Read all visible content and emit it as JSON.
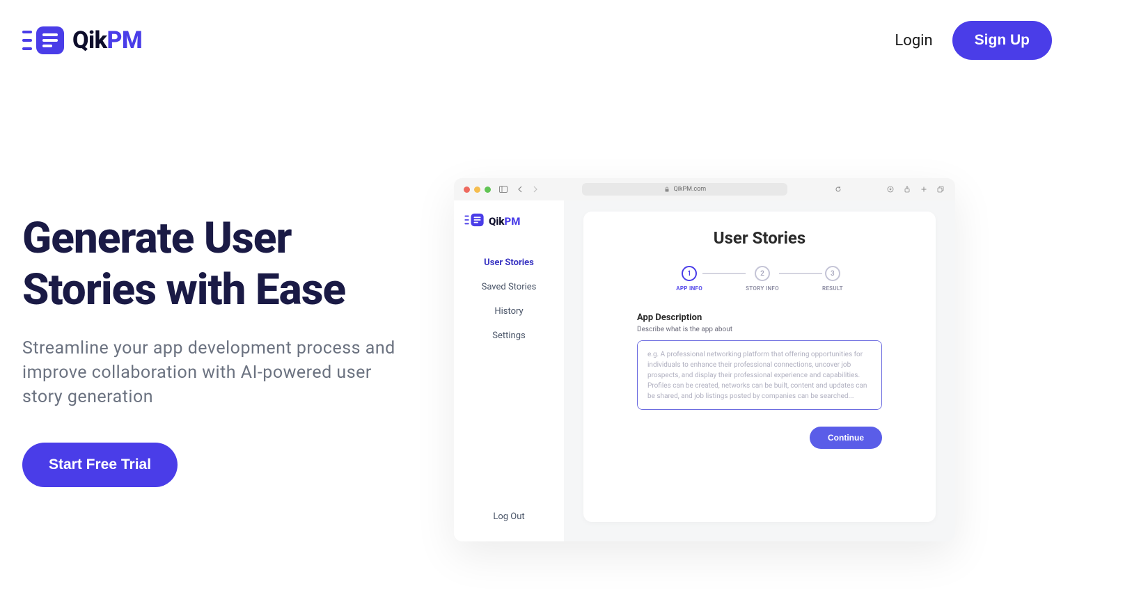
{
  "header": {
    "logo_qik": "Qik",
    "logo_pm": "PM",
    "login_label": "Login",
    "signup_label": "Sign Up"
  },
  "hero": {
    "title": "Generate User Stories with Ease",
    "subtitle": "Streamline your app development process and improve collaboration with AI-powered user story generation",
    "cta_label": "Start Free Trial"
  },
  "browser": {
    "url_label": "QikPM.com",
    "app_logo_qik": "Qik",
    "app_logo_pm": "PM",
    "sidebar": {
      "items": [
        {
          "label": "User Stories",
          "active": true
        },
        {
          "label": "Saved Stories",
          "active": false
        },
        {
          "label": "History",
          "active": false
        },
        {
          "label": "Settings",
          "active": false
        }
      ],
      "logout": "Log Out"
    },
    "main": {
      "title": "User Stories",
      "steps": [
        {
          "num": "1",
          "label": "APP INFO"
        },
        {
          "num": "2",
          "label": "STORY INFO"
        },
        {
          "num": "3",
          "label": "RESULT"
        }
      ],
      "form_label": "App Description",
      "form_sublabel": "Describe what is the app about",
      "form_placeholder": "e.g. A professional networking platform that offering opportunities for individuals to enhance their professional connections, uncover job prospects, and display their professional experience and capabilities. Profiles can be created, networks can be built, content and updates can be shared, and job listings posted by companies can be searched...",
      "continue_label": "Continue"
    }
  },
  "colors": {
    "primary": "#4a3de8",
    "dark": "#1a1a45",
    "gray": "#6b7280"
  }
}
